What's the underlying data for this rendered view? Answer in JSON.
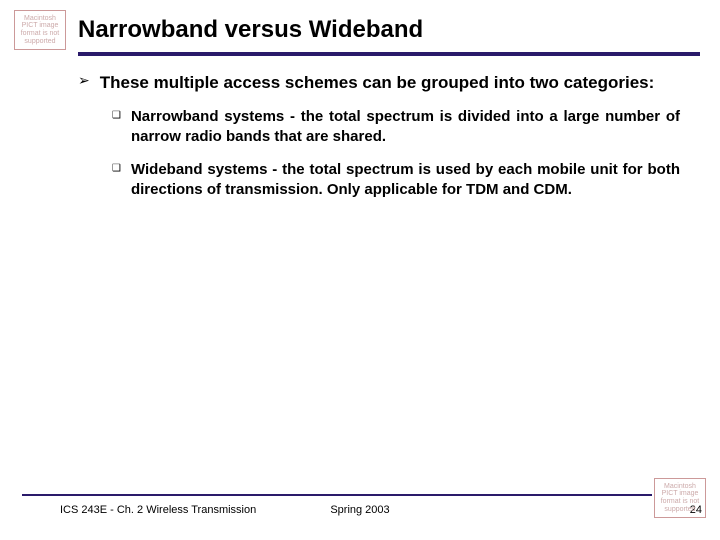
{
  "pict_error": "Macintosh PICT image format is not supported",
  "title": "Narrowband versus Wideband",
  "level1": {
    "bullet": "➢",
    "text": "These multiple access schemes can be grouped into two categories:"
  },
  "level2": [
    {
      "bullet": "❑",
      "text": "Narrowband systems - the total spectrum is divided into a large number of narrow radio bands that are shared."
    },
    {
      "bullet": "❑",
      "text": "Wideband systems - the total spectrum is used by each mobile unit for both directions of transmission. Only applicable for TDM and CDM."
    }
  ],
  "footer": {
    "left": "ICS 243E - Ch. 2 Wireless Transmission",
    "center": "Spring 2003",
    "right": "24"
  }
}
